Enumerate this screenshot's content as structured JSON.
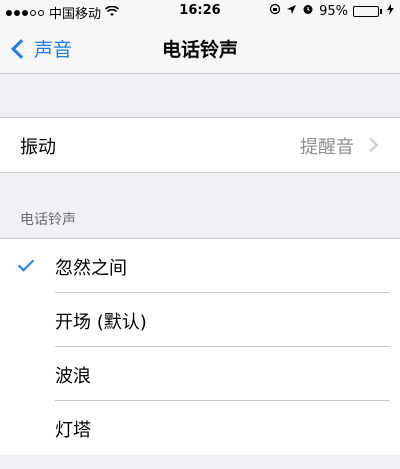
{
  "status_bar": {
    "carrier": "中国移动",
    "time": "16:26",
    "battery": "95%",
    "battery_level": 0.95,
    "signal_full": 3,
    "signal_total": 5
  },
  "nav": {
    "back_label": "声音",
    "title": "电话铃声"
  },
  "vibration": {
    "label": "振动",
    "value": "提醒音"
  },
  "ringtone_section": {
    "header": "电话铃声",
    "items": [
      {
        "label": "忽然之间",
        "selected": true
      },
      {
        "label": "开场 (默认)",
        "selected": false
      },
      {
        "label": "波浪",
        "selected": false
      },
      {
        "label": "灯塔",
        "selected": false
      }
    ]
  },
  "colors": {
    "accent": "#1a7cf0",
    "battery": "#3fbf2f",
    "background": "#efeff4"
  }
}
